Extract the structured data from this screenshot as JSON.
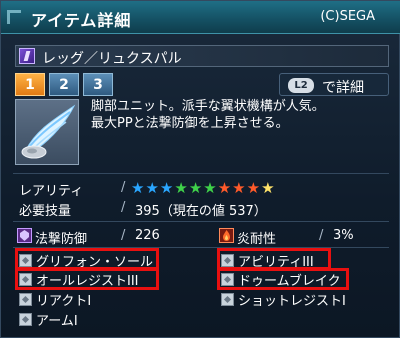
{
  "window": {
    "title": "アイテム詳細",
    "copyright": "(C)SEGA"
  },
  "item": {
    "category_icon": "leg-unit-icon",
    "name": "レッグ／リュクスパル",
    "description_line1": "脚部ユニット。派手な翼状機構が人気。",
    "description_line2": "最大PPと法撃防御を上昇させる。"
  },
  "tabs": [
    {
      "label": "1",
      "active": true
    },
    {
      "label": "2",
      "active": false
    },
    {
      "label": "3",
      "active": false
    }
  ],
  "detail_hint": {
    "button": "L2",
    "label": "で詳細"
  },
  "stats": {
    "rarity_label": "レアリティ",
    "rarity_stars": 10,
    "star_colors": [
      "#2aa6ff",
      "#2aa6ff",
      "#2aa6ff",
      "#3fd14a",
      "#3fd14a",
      "#3fd14a",
      "#ff5a2a",
      "#ff5a2a",
      "#ff5a2a",
      "#ffe36a"
    ],
    "skill_label": "必要技量",
    "skill_value": "395（現在の値 537）",
    "tech_def_label": "法撃防御",
    "tech_def_value": "226",
    "fire_res_label": "炎耐性",
    "fire_res_value": "3%"
  },
  "abilities": {
    "left": [
      "グリフォン・ソール",
      "オールレジストIII",
      "リアクトI",
      "アームI"
    ],
    "right": [
      "アビリティIII",
      "ドゥームブレイク",
      "ショットレジストI"
    ]
  },
  "colors": {
    "highlight": "#e81010",
    "title_bar": "#155265"
  }
}
